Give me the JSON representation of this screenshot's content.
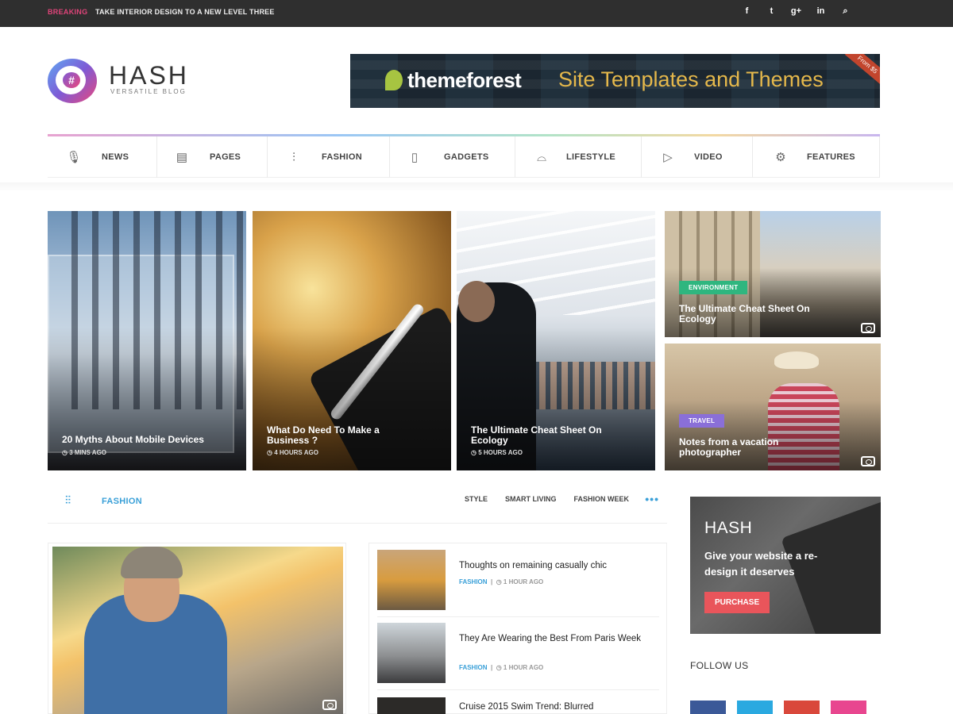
{
  "topbar": {
    "breaking_label": "BREAKING",
    "ticker_text": "TAKE INTERIOR DESIGN TO A NEW LEVEL THREE",
    "social": [
      {
        "icon": "facebook-icon",
        "glyph": "f"
      },
      {
        "icon": "twitter-icon",
        "glyph": "t"
      },
      {
        "icon": "google-plus-icon",
        "glyph": "g+"
      },
      {
        "icon": "linkedin-icon",
        "glyph": "in"
      },
      {
        "icon": "search-icon",
        "glyph": "⌕"
      }
    ]
  },
  "logo": {
    "title": "HASH",
    "subtitle": "VERSATILE BLOG",
    "badge_glyph": "#"
  },
  "banner": {
    "brand": "themeforest",
    "tagline": "Site Templates and Themes",
    "corner": "From $5"
  },
  "nav": {
    "items": [
      {
        "label": "NEWS",
        "icon": "microphone-icon",
        "glyph": "🎙"
      },
      {
        "label": "PAGES",
        "icon": "document-icon",
        "glyph": "▤"
      },
      {
        "label": "FASHION",
        "icon": "sliders-icon",
        "glyph": "⫶"
      },
      {
        "label": "GADGETS",
        "icon": "tablet-icon",
        "glyph": "▯"
      },
      {
        "label": "LIFESTYLE",
        "icon": "basket-icon",
        "glyph": "⌓"
      },
      {
        "label": "VIDEO",
        "icon": "play-circle-icon",
        "glyph": "▷"
      },
      {
        "label": "FEATURES",
        "icon": "gears-icon",
        "glyph": "⚙"
      }
    ]
  },
  "grid": {
    "posts": [
      {
        "title": "20 Myths About Mobile Devices",
        "meta": "3 MINS AGO"
      },
      {
        "title": "What Do Need To Make a Business ?",
        "meta": "4 HOURS AGO"
      },
      {
        "title": "The Ultimate Cheat Sheet On Ecology",
        "meta": "5 HOURS AGO"
      },
      {
        "title": "The Ultimate Cheat Sheet On Ecology",
        "category": "ENVIRONMENT"
      },
      {
        "title": "Notes from a vacation photographer",
        "category": "TRAVEL"
      }
    ]
  },
  "fashion": {
    "label": "FASHION",
    "tabs": [
      "STYLE",
      "SMART LIVING",
      "FASHION WEEK"
    ],
    "more": "•••",
    "list": [
      {
        "title": "Thoughts on remaining casually chic",
        "category": "FASHION",
        "time": "1 HOUR AGO"
      },
      {
        "title": "They Are Wearing the Best From Paris Week",
        "category": "FASHION",
        "time": "1 HOUR AGO"
      },
      {
        "title": "Cruise 2015 Swim Trend: Blurred"
      }
    ]
  },
  "sidebar": {
    "ad_title": "HASH",
    "ad_text": "Give your website a re-design it deserves",
    "ad_button": "PURCHASE",
    "follow_label": "FOLLOW US"
  },
  "colors": {
    "accent": "#3aa0d8",
    "breaking": "#e0447a",
    "environment": "#2fb67f",
    "travel": "#8a6fd8",
    "purchase": "#e9555b"
  }
}
